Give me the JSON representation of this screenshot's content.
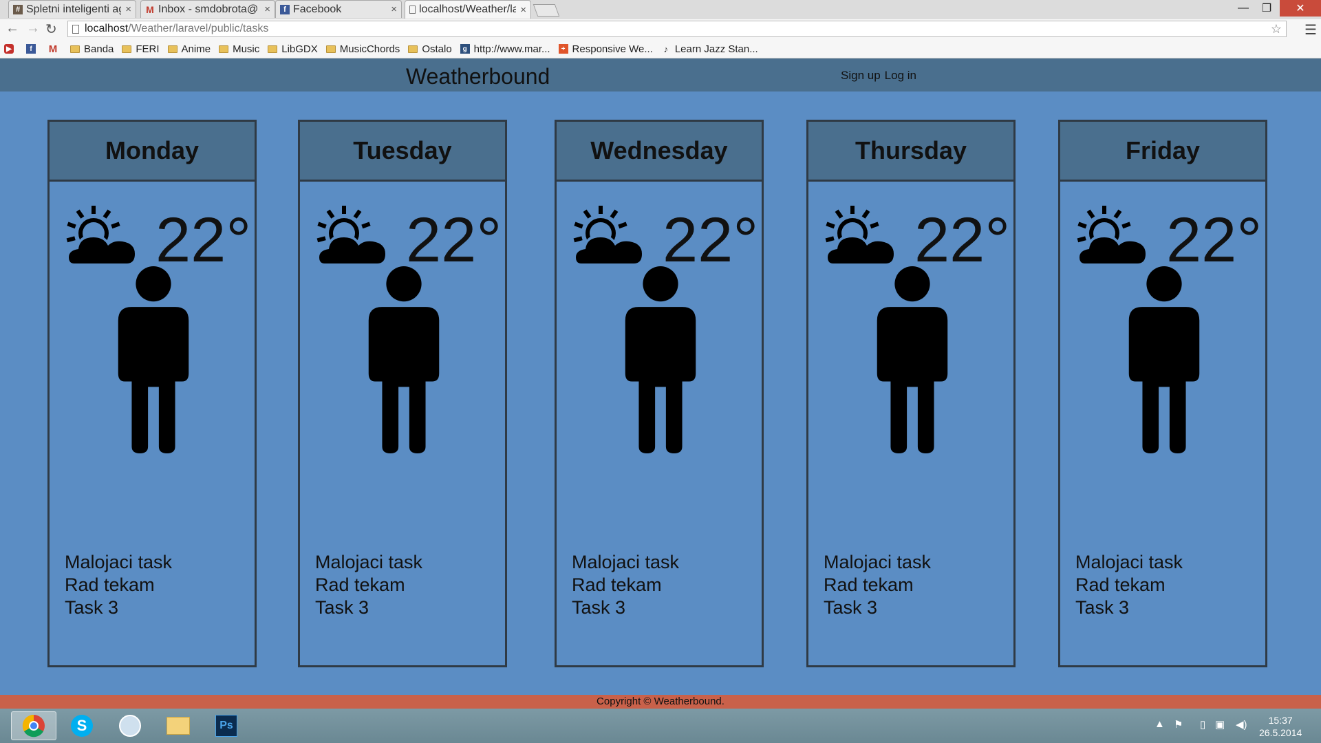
{
  "browser": {
    "tabs": [
      {
        "title": "Spletni inteligenti ag",
        "favicon": "hash-icon",
        "active": false
      },
      {
        "title": "Inbox - smdobrota@",
        "favicon": "gmail-icon",
        "active": false
      },
      {
        "title": "Facebook",
        "favicon": "facebook-icon",
        "active": false
      },
      {
        "title": "localhost/Weather/la",
        "favicon": "page-icon",
        "active": true
      }
    ],
    "url_host": "localhost",
    "url_path": "/Weather/laravel/public/tasks",
    "bookmarks": [
      "Banda",
      "FERI",
      "Anime",
      "Music",
      "LibGDX",
      "MusicChords",
      "Ostalo",
      "http://www.mar...",
      "Responsive We...",
      "Learn Jazz Stan..."
    ]
  },
  "site": {
    "brand": "Weatherbound",
    "signup": "Sign up",
    "login": "Log in"
  },
  "days": [
    {
      "name": "Monday",
      "temp": "22°",
      "weather_icon": "partly-cloudy-icon",
      "tasks": [
        "Malojaci task",
        "Rad tekam",
        "Task 3"
      ]
    },
    {
      "name": "Tuesday",
      "temp": "22°",
      "weather_icon": "partly-cloudy-icon",
      "tasks": [
        "Malojaci task",
        "Rad tekam",
        "Task 3"
      ]
    },
    {
      "name": "Wednesday",
      "temp": "22°",
      "weather_icon": "partly-cloudy-icon",
      "tasks": [
        "Malojaci task",
        "Rad tekam",
        "Task 3"
      ]
    },
    {
      "name": "Thursday",
      "temp": "22°",
      "weather_icon": "partly-cloudy-icon",
      "tasks": [
        "Malojaci task",
        "Rad tekam",
        "Task 3"
      ]
    },
    {
      "name": "Friday",
      "temp": "22°",
      "weather_icon": "partly-cloudy-icon",
      "tasks": [
        "Malojaci task",
        "Rad tekam",
        "Task 3"
      ]
    }
  ],
  "footer": "Copyright © Weatherbound.",
  "taskbar": {
    "apps": [
      "chrome-icon",
      "skype-icon",
      "app-icon",
      "folder-icon",
      "photoshop-icon"
    ],
    "time": "15:37",
    "date": "26.5.2014"
  },
  "colors": {
    "page_bg": "#5b8dc4",
    "navbar": "#4a6f8e",
    "footer": "#c9614a"
  }
}
